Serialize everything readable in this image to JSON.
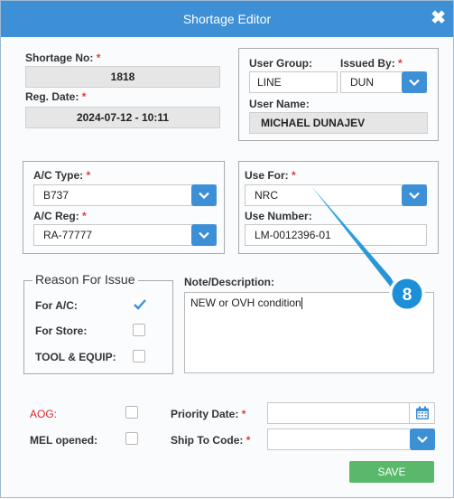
{
  "window": {
    "title": "Shortage Editor",
    "close_glyph": "✖"
  },
  "shortage": {
    "no_label": "Shortage No:",
    "no_value": "1818",
    "reg_label": "Reg. Date:",
    "reg_value": "2024-07-12 - 10:11"
  },
  "user": {
    "group_label": "User Group:",
    "group_value": "LINE",
    "issued_label": "Issued By:",
    "issued_value": "DUN",
    "name_label": "User Name:",
    "name_value": "MICHAEL DUNAJEV"
  },
  "aircraft": {
    "type_label": "A/C Type:",
    "type_value": "B737",
    "reg_label": "A/C Reg:",
    "reg_value": "RA-77777"
  },
  "use": {
    "for_label": "Use For:",
    "for_value": "NRC",
    "number_label": "Use Number:",
    "number_value": "LM-0012396-01"
  },
  "reason": {
    "legend": "Reason For Issue",
    "items": [
      {
        "label": "For A/C:",
        "checked": true
      },
      {
        "label": "For Store:",
        "checked": false
      },
      {
        "label": "TOOL & EQUIP:",
        "checked": false
      }
    ]
  },
  "note": {
    "label": "Note/Description:",
    "value": "NEW or OVH condition"
  },
  "bottom": {
    "aog_label": "AOG:",
    "mel_label": "MEL opened:",
    "priority_label": "Priority Date:",
    "ship_label": "Ship To Code:",
    "priority_value": "",
    "ship_value": ""
  },
  "save_label": "SAVE",
  "required_mark": "*",
  "callout": {
    "number": "8"
  },
  "colors": {
    "accent": "#3d8fd6",
    "save": "#59b86a",
    "required": "#e23a3a",
    "aog": "#d9272e"
  },
  "icons": [
    "close-icon",
    "chevron-down-icon",
    "checkmark-icon",
    "calendar-icon"
  ]
}
